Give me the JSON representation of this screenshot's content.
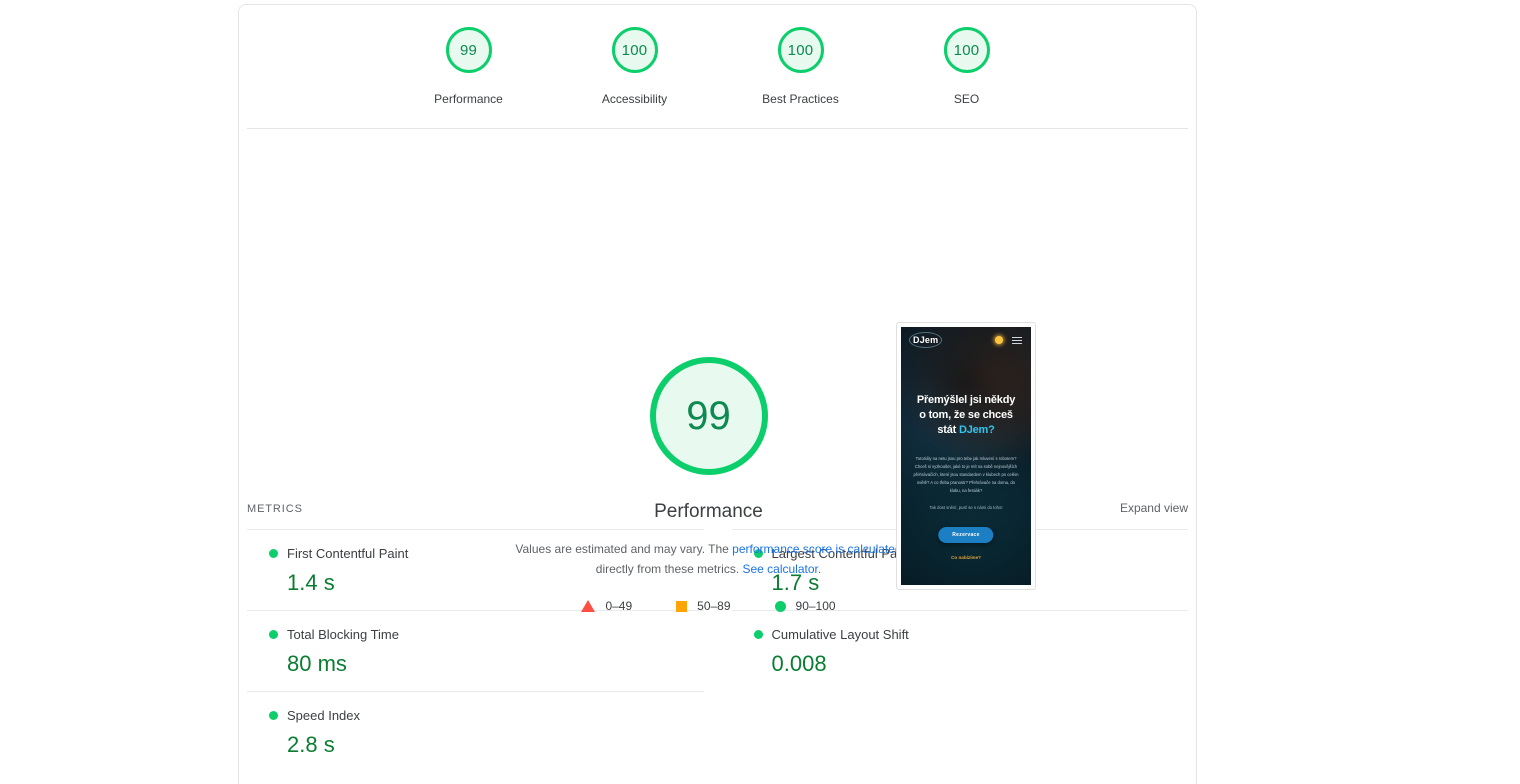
{
  "scores": [
    {
      "value": "99",
      "label": "Performance",
      "icon": "score-gauge-icon"
    },
    {
      "value": "100",
      "label": "Accessibility",
      "icon": "score-gauge-icon"
    },
    {
      "value": "100",
      "label": "Best Practices",
      "icon": "score-gauge-icon"
    },
    {
      "value": "100",
      "label": "SEO",
      "icon": "score-gauge-icon"
    }
  ],
  "hero": {
    "gauge_value": "99",
    "category_title": "Performance",
    "desc_part1": "Values are estimated and may vary. The ",
    "desc_link1": "performance score is calculated",
    "desc_part2": " directly from these metrics. ",
    "desc_link2": "See calculator.",
    "legend": [
      {
        "range": "0–49",
        "swatch": "triangle",
        "color": "#ff4e42"
      },
      {
        "range": "50–89",
        "swatch": "square",
        "color": "#ffa400"
      },
      {
        "range": "90–100",
        "swatch": "circle",
        "color": "#0cce6b"
      }
    ]
  },
  "filmstrip": {
    "logo": "DJem",
    "theme_toggle_icon": "sun-icon",
    "menu_icon": "hamburger-menu-icon",
    "headline_line1": "Přemýšlel jsi někdy",
    "headline_line2": "o tom, že se chceš",
    "headline_line3_pre": "stát ",
    "headline_line3_highlight": "DJem?",
    "body": "Tutoriály na netu jsou pro tebe jak mluvení s robotem? Chceš si vyzkoušet, jaké to je mít na sobě nejnovějších přehrávačích, které jsou standardem v klubech po celém světě? A co třeba pranostr? Přehrávače na doma, do klubu, na festiák?",
    "tagline": "Tak dost snění, pusť se s námi do toho!",
    "cta_label": "Rezervace",
    "secondary_link": "Co nabízíme?"
  },
  "metrics": {
    "section_title": "METRICS",
    "expand_label": "Expand view",
    "items": [
      {
        "name": "First Contentful Paint",
        "value": "1.4 s",
        "status": "pass"
      },
      {
        "name": "Largest Contentful Paint",
        "value": "1.7 s",
        "status": "pass"
      },
      {
        "name": "Total Blocking Time",
        "value": "80 ms",
        "status": "pass"
      },
      {
        "name": "Cumulative Layout Shift",
        "value": "0.008",
        "status": "pass"
      },
      {
        "name": "Speed Index",
        "value": "2.8 s",
        "status": "pass"
      }
    ]
  },
  "colors": {
    "pass_green": "#0cce6b",
    "value_green": "#0a7d32",
    "average_orange": "#ffa400",
    "fail_red": "#ff4e42",
    "link_blue": "#1a73e8"
  }
}
